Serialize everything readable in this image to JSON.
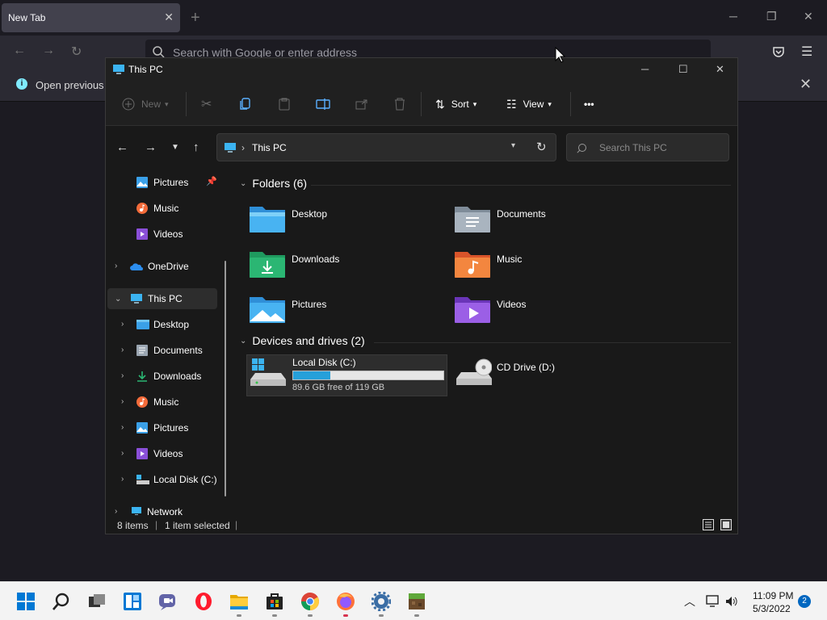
{
  "browser": {
    "tab_title": "New Tab",
    "url_placeholder": "Search with Google or enter address",
    "notice_text": "Open previous ta"
  },
  "explorer": {
    "title": "This PC",
    "toolbar": {
      "new_label": "New",
      "sort_label": "Sort",
      "view_label": "View",
      "more_label": "•••"
    },
    "address": "This PC",
    "search_placeholder": "Search This PC",
    "nav": [
      {
        "label": "Pictures",
        "icon": "pictures-icon",
        "pinned": true
      },
      {
        "label": "Music",
        "icon": "music-icon"
      },
      {
        "label": "Videos",
        "icon": "videos-icon"
      },
      {
        "label": "OneDrive",
        "icon": "onedrive-icon"
      },
      {
        "label": "This PC",
        "icon": "this-pc-icon",
        "selected": true
      },
      {
        "label": "Desktop",
        "icon": "desktop-icon"
      },
      {
        "label": "Documents",
        "icon": "documents-icon"
      },
      {
        "label": "Downloads",
        "icon": "downloads-icon"
      },
      {
        "label": "Music",
        "icon": "music-icon"
      },
      {
        "label": "Pictures",
        "icon": "pictures-icon"
      },
      {
        "label": "Videos",
        "icon": "videos-icon"
      },
      {
        "label": "Local Disk (C:)",
        "icon": "local-disk-icon"
      },
      {
        "label": "Network",
        "icon": "network-icon"
      }
    ],
    "folders_header": "Folders (6)",
    "folders": [
      {
        "label": "Desktop",
        "icon": "desktop-folder-icon"
      },
      {
        "label": "Documents",
        "icon": "documents-folder-icon"
      },
      {
        "label": "Downloads",
        "icon": "downloads-folder-icon"
      },
      {
        "label": "Music",
        "icon": "music-folder-icon"
      },
      {
        "label": "Pictures",
        "icon": "pictures-folder-icon"
      },
      {
        "label": "Videos",
        "icon": "videos-folder-icon"
      }
    ],
    "drives_header": "Devices and drives (2)",
    "drives": [
      {
        "label": "Local Disk (C:)",
        "free_text": "89.6 GB free of 119 GB",
        "used_fraction": 0.247
      },
      {
        "label": "CD Drive (D:)"
      }
    ],
    "status": {
      "items": "8 items",
      "selected": "1 item selected"
    }
  },
  "taskbar": {
    "time": "11:09 PM",
    "date": "5/3/2022",
    "notification_count": "2",
    "apps": [
      "start-icon",
      "search-icon",
      "task-view-icon",
      "widgets-icon",
      "chat-icon",
      "opera-icon",
      "file-explorer-icon",
      "store-icon",
      "chrome-icon",
      "firefox-icon",
      "settings-icon",
      "minecraft-icon"
    ]
  },
  "colors": {
    "accent": "#26a0da",
    "folder_blue": "#3aa0e8",
    "downloads_green": "#2bb673",
    "music_orange": "#f36b3a",
    "videos_purple": "#8a4fd8"
  }
}
